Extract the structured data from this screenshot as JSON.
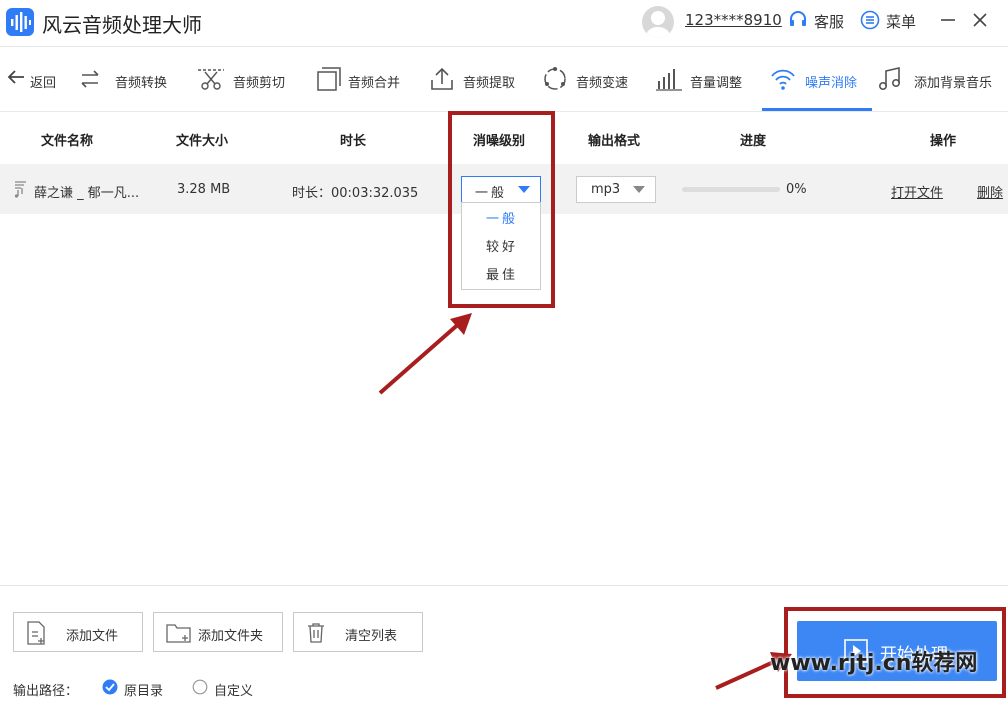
{
  "app": {
    "title": "风云音频处理大师",
    "user": "123****8910",
    "support": "客服",
    "menu": "菜单"
  },
  "toolbar": {
    "back": "返回",
    "items": [
      "音频转换",
      "音频剪切",
      "音频合并",
      "音频提取",
      "音频变速",
      "音量调整",
      "噪声消除",
      "添加背景音乐"
    ],
    "active": "噪声消除"
  },
  "table": {
    "headers": {
      "name": "文件名称",
      "size": "文件大小",
      "duration": "时长",
      "level": "消噪级别",
      "format": "输出格式",
      "progress": "进度",
      "action": "操作"
    },
    "row": {
      "name": "薛之谦 _ 郁一凡...",
      "size": "3.28 MB",
      "duration": "时长：00:03:32.035",
      "level": "一般",
      "format": "mp3",
      "progress_text": "0%",
      "progress": 0,
      "open": "打开文件",
      "delete": "删除"
    },
    "level_options": [
      "一般",
      "较好",
      "最佳"
    ]
  },
  "bottom": {
    "add_file": "添加文件",
    "add_folder": "添加文件夹",
    "clear": "清空列表",
    "output_path_label": "输出路径：",
    "opt_original": "原目录",
    "opt_custom": "自定义",
    "start": "开始处理"
  },
  "watermark": "www.rjtj.cn软荐网",
  "colors": {
    "accent": "#2f7cf6",
    "highlight": "#a81e1e",
    "start_button": "#3d87f5"
  }
}
